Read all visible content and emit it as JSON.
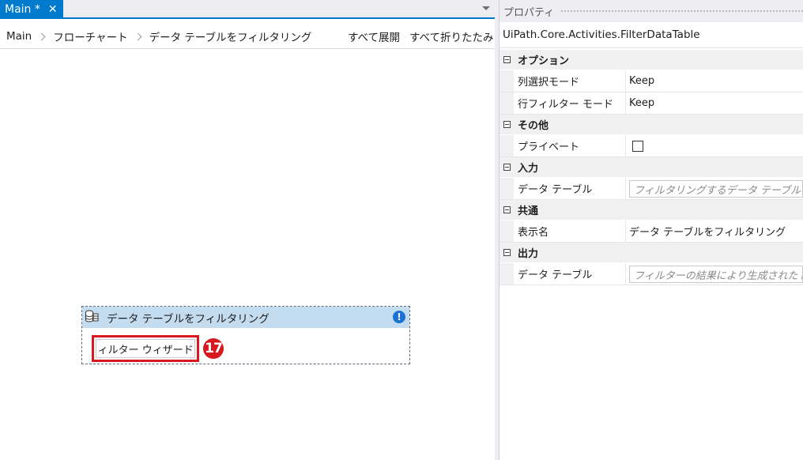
{
  "tab": {
    "title": "Main *",
    "close_glyph": "✕"
  },
  "breadcrumb": [
    "Main",
    "フローチャート",
    "データ テーブルをフィルタリング"
  ],
  "toolbar": {
    "expand_all": "すべて展開",
    "collapse_all": "すべて折りたたみ"
  },
  "activity": {
    "title": "データ テーブルをフィルタリング",
    "icon": "database-table-icon",
    "warning_glyph": "!",
    "wizard_button": "フィルター ウィザード...",
    "step_badge": "17"
  },
  "properties": {
    "panel_title": "プロパティ",
    "activity_type": "UiPath.Core.Activities.FilterDataTable",
    "categories": [
      {
        "name": "オプション",
        "rows": [
          {
            "name": "列選択モード",
            "value": "Keep"
          },
          {
            "name": "行フィルター モード",
            "value": "Keep"
          }
        ]
      },
      {
        "name": "その他",
        "rows": [
          {
            "name": "プライベート",
            "checked": false
          }
        ]
      },
      {
        "name": "入力",
        "rows": [
          {
            "name": "データ テーブル",
            "placeholder": "フィルタリングするデータ テーブルです。"
          }
        ]
      },
      {
        "name": "共通",
        "rows": [
          {
            "name": "表示名",
            "value": "データ テーブルをフィルタリング"
          }
        ]
      },
      {
        "name": "出力",
        "rows": [
          {
            "name": "データ テーブル",
            "placeholder": "フィルターの結果により生成された Da"
          }
        ]
      }
    ]
  },
  "colors": {
    "accent": "#007acc",
    "activity_header": "#c4dcef",
    "highlight": "#d71920"
  }
}
